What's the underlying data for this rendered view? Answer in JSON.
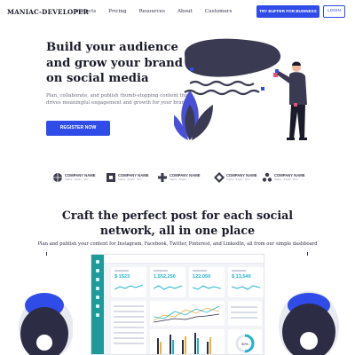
{
  "nav": {
    "brand": "MANIAC-DEVELOPER",
    "links": [
      "Products",
      "Pricing",
      "Resources",
      "About",
      "Customers"
    ],
    "cta_try": "TRY BUFFER FOR BUSINESS",
    "cta_login": "LOGIN"
  },
  "hero": {
    "title_lines": [
      "Build your audience",
      "and grow your brand",
      "on social media"
    ],
    "subtitle": "Plan, collaborate, and publish thumb-stopping content that drives meaningful engagement and growth for your brand",
    "cta_register": "REGISTER NOW"
  },
  "logos": [
    {
      "name": "COMPANY NAME",
      "tagline": "Tagline · Slogan · Here"
    },
    {
      "name": "COMPANY NAME",
      "tagline": "Tagline · Slogan · Here"
    },
    {
      "name": "COMPANY NAME",
      "tagline": "Tagline · Slogan"
    },
    {
      "name": "COMPANY NAME",
      "tagline": "Tagline · Slogan · Here"
    },
    {
      "name": "COMPANY NAME",
      "tagline": "Tagline · Slogan · Here"
    }
  ],
  "section": {
    "title_lines": [
      "Craft the perfect post for each social",
      "network, all in one place"
    ],
    "subtitle": "Plan and publish your content for Instagram, Facebook, Twitter, Pinterest, and LinkedIn, all from our simple dashboard"
  },
  "dashboard": {
    "stats": [
      "$ 1523",
      "1,552,250",
      "122,050",
      "$ 13,540"
    ],
    "donut_label": "50%"
  },
  "colors": {
    "primary": "#2f4be8",
    "dark": "#3a3b52",
    "teal": "#1f9a9a",
    "accent_pink": "#e8507a",
    "text": "#1b1c2b"
  }
}
